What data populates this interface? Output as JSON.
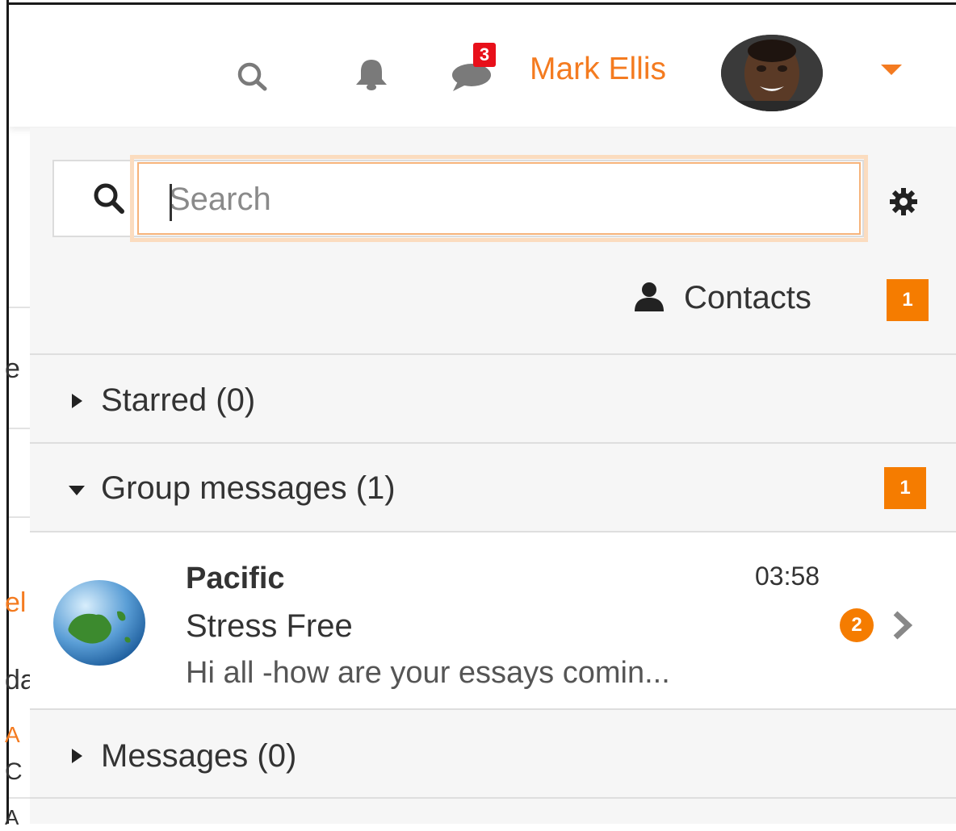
{
  "navbar": {
    "search_icon": "search-icon",
    "notifications_icon": "bell-icon",
    "messages_icon": "chat-icon",
    "messages_badge": "3",
    "user_name": "Mark Ellis",
    "user_menu_icon": "caret-down-icon"
  },
  "page_fragments": [
    "e",
    "el",
    "da",
    "A",
    "C",
    "A"
  ],
  "drawer": {
    "search": {
      "placeholder": "Search",
      "value": ""
    },
    "settings_icon": "gear-icon",
    "contacts": {
      "label": "Contacts",
      "badge": "1"
    },
    "sections": [
      {
        "label": "Starred (0)",
        "expanded": false
      },
      {
        "label": "Group messages (1)",
        "expanded": true,
        "badge": "1"
      },
      {
        "label": "Messages (0)",
        "expanded": false
      }
    ],
    "conversation": {
      "group": "Pacific",
      "time": "03:58",
      "title": "Stress Free",
      "preview": "Hi all -how are your essays comin...",
      "unread": "2"
    }
  },
  "colors": {
    "accent": "#f47b20",
    "badge_orange": "#f57c00",
    "badge_red": "#e8101a",
    "drawer_bg": "#f6f6f6"
  }
}
